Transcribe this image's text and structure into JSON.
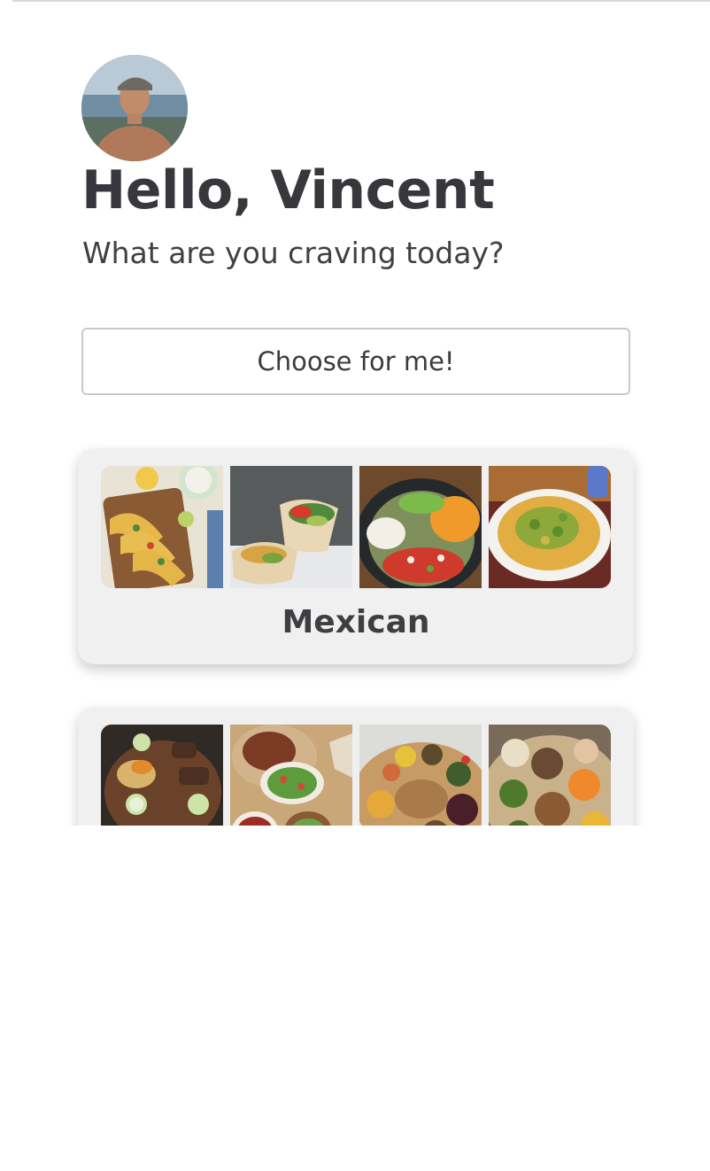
{
  "header": {
    "greeting": "Hello, Vincent",
    "subtitle": "What are you craving today?"
  },
  "actions": {
    "choose_label": "Choose for me!"
  },
  "categories": [
    {
      "label": "Mexican",
      "images": [
        "tacos",
        "burrito",
        "salsa bowl",
        "nachos"
      ]
    },
    {
      "label": "",
      "images": [
        "injera platter",
        "lentil stew plate",
        "combination platter",
        "mixed platter"
      ]
    }
  ],
  "colors": {
    "text": "#37383b",
    "card_background": "#f0f0f1",
    "button_border": "#c9c9cb"
  }
}
